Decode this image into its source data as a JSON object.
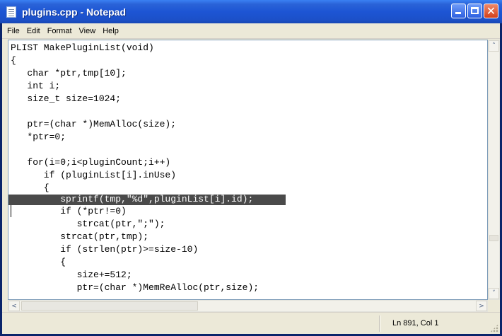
{
  "window": {
    "title": "plugins.cpp - Notepad"
  },
  "menu": {
    "items": [
      "File",
      "Edit",
      "Format",
      "View",
      "Help"
    ]
  },
  "editor": {
    "lines": [
      "PLIST MakePluginList(void)",
      "{",
      "   char *ptr,tmp[10];",
      "   int i;",
      "   size_t size=1024;",
      "",
      "   ptr=(char *)MemAlloc(size);",
      "   *ptr=0;",
      "",
      "   for(i=0;i<pluginCount;i++)",
      "      if (pluginList[i].inUse)",
      "      {",
      "         sprintf(tmp,\"%d\",pluginList[i].id);",
      "         if (*ptr!=0)",
      "            strcat(ptr,\";\");",
      "         strcat(ptr,tmp);",
      "         if (strlen(ptr)>=size-10)",
      "         {",
      "            size+=512;",
      "            ptr=(char *)MemReAlloc(ptr,size);"
    ],
    "selected_line_index": 12
  },
  "scrollbars": {
    "up_arrow": "˄",
    "down_arrow": "˅",
    "left_arrow": "<",
    "right_arrow": ">"
  },
  "statusbar": {
    "position": "Ln 891, Col 1"
  },
  "titlebar_buttons": {
    "minimize_icon": "minimize-icon",
    "maximize_icon": "maximize-icon",
    "close_glyph": "✕"
  }
}
